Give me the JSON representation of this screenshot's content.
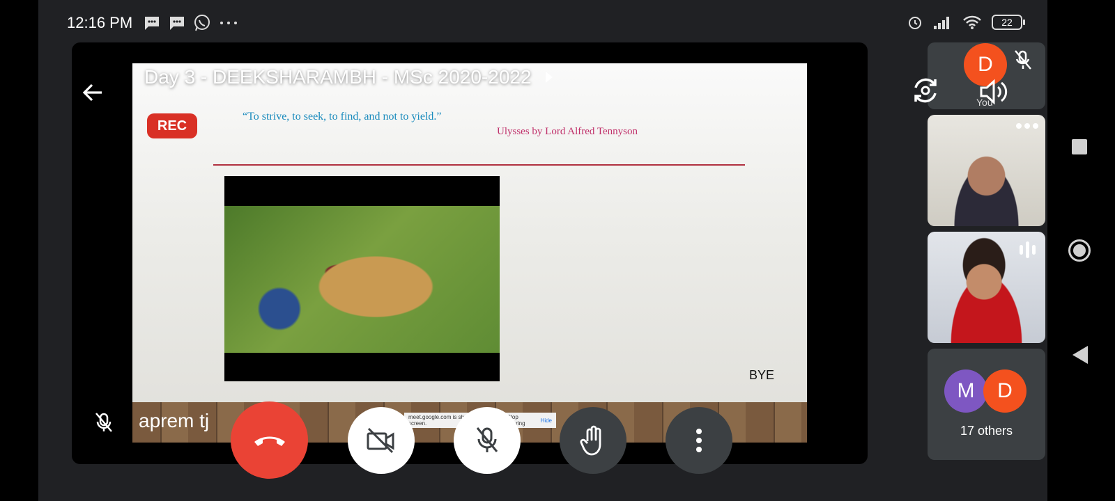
{
  "status_bar": {
    "time": "12:16 PM",
    "battery": "22",
    "left_icons": [
      "message-icon",
      "message-icon",
      "whatsapp-icon",
      "more-dots-icon"
    ],
    "right_icons": [
      "alarm-icon",
      "signal-icon",
      "wifi-icon",
      "battery-icon"
    ]
  },
  "presentation": {
    "title": "Day 3 - DEEKSHARAMBH - MSc 2020-2022",
    "rec_label": "REC",
    "slide": {
      "quote": "“To strive, to seek, to find, and not to yield.”",
      "attribution": "Ulysses   by Lord Alfred Tennyson",
      "footer_text": "BYE",
      "share_notice": "meet.google.com is sharing your screen.",
      "share_stop": "Stop sharing",
      "share_hide": "Hide"
    },
    "presenter_name": "aprem tj"
  },
  "controls": {
    "end_call": "phone-hangup-icon",
    "camera": "camera-off-icon",
    "mic": "mic-off-icon",
    "hand": "raise-hand-icon",
    "more": "more-vert-icon"
  },
  "participants": {
    "self": {
      "initial": "D",
      "label": "You",
      "color": "#f4511e"
    },
    "others_avatars": [
      {
        "initial": "M",
        "color": "#7e57c2"
      },
      {
        "initial": "D",
        "color": "#f4511e"
      }
    ],
    "others_label": "17 others"
  },
  "colors": {
    "end_call": "#ea4335",
    "tile_bg": "#3c4043",
    "rec": "#d93025"
  }
}
